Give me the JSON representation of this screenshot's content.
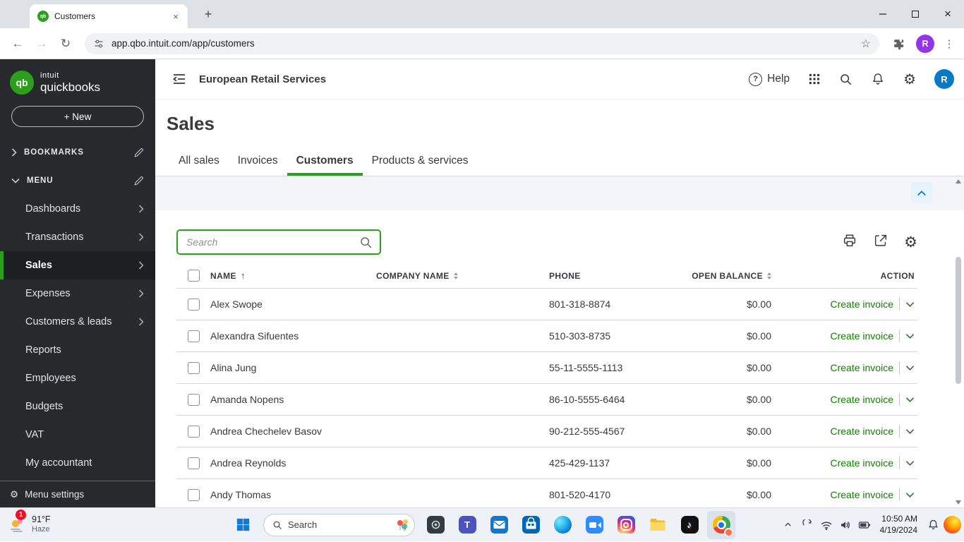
{
  "icons": {
    "back": "←",
    "forward": "→",
    "reload": "↻",
    "star": "☆",
    "kebab": "⋮",
    "close": "×",
    "plus": "+",
    "gear": "⚙",
    "sort_asc": "↑",
    "question": "?",
    "note": "♪"
  },
  "browser": {
    "tab_title": "Customers",
    "url": "app.qbo.intuit.com/app/customers",
    "profile_initial": "R"
  },
  "qbo": {
    "logo": {
      "monogram": "qb",
      "intuit": "intuit",
      "product": "quickbooks"
    },
    "new_button": "+ New",
    "sidebar": {
      "bookmarks": "BOOKMARKS",
      "menu": "MENU",
      "items": [
        {
          "label": "Dashboards",
          "chevron": true
        },
        {
          "label": "Transactions",
          "chevron": true
        },
        {
          "label": "Sales",
          "chevron": true,
          "active": true
        },
        {
          "label": "Expenses",
          "chevron": true
        },
        {
          "label": "Customers & leads",
          "chevron": true
        },
        {
          "label": "Reports"
        },
        {
          "label": "Employees"
        },
        {
          "label": "Budgets"
        },
        {
          "label": "VAT"
        },
        {
          "label": "My accountant"
        }
      ],
      "menu_settings": "Menu settings"
    },
    "header": {
      "company": "European Retail Services",
      "help": "Help",
      "avatar_initial": "R"
    },
    "page_title": "Sales",
    "tabs": [
      "All sales",
      "Invoices",
      "Customers",
      "Products & services"
    ],
    "active_tab": "Customers",
    "search_placeholder": "Search",
    "table": {
      "headers": {
        "name": "NAME",
        "company": "COMPANY NAME",
        "phone": "PHONE",
        "balance": "OPEN BALANCE",
        "action": "ACTION"
      },
      "action_label": "Create invoice",
      "rows": [
        {
          "name": "Alex Swope",
          "company": "",
          "phone": "801-318-8874",
          "balance": "$0.00"
        },
        {
          "name": "Alexandra Sifuentes",
          "company": "",
          "phone": "510-303-8735",
          "balance": "$0.00"
        },
        {
          "name": "Alina Jung",
          "company": "",
          "phone": "55-11-5555-1113",
          "balance": "$0.00"
        },
        {
          "name": "Amanda Nopens",
          "company": "",
          "phone": "86-10-5555-6464",
          "balance": "$0.00"
        },
        {
          "name": "Andrea Chechelev Basov",
          "company": "",
          "phone": "90-212-555-4567",
          "balance": "$0.00"
        },
        {
          "name": "Andrea Reynolds",
          "company": "",
          "phone": "425-429-1137",
          "balance": "$0.00"
        },
        {
          "name": "Andy Thomas",
          "company": "",
          "phone": "801-520-4170",
          "balance": "$0.00"
        }
      ]
    }
  },
  "taskbar": {
    "weather": {
      "temp": "91°F",
      "condition": "Haze",
      "badge": "1"
    },
    "search_label": "Search",
    "clock": {
      "time": "10:50 AM",
      "date": "4/19/2024"
    }
  },
  "colors": {
    "qbo_green": "#2ca01c",
    "link_green": "#108000",
    "app_avatar_blue": "#0779c7",
    "browser_avatar_purple": "#9334e6"
  }
}
